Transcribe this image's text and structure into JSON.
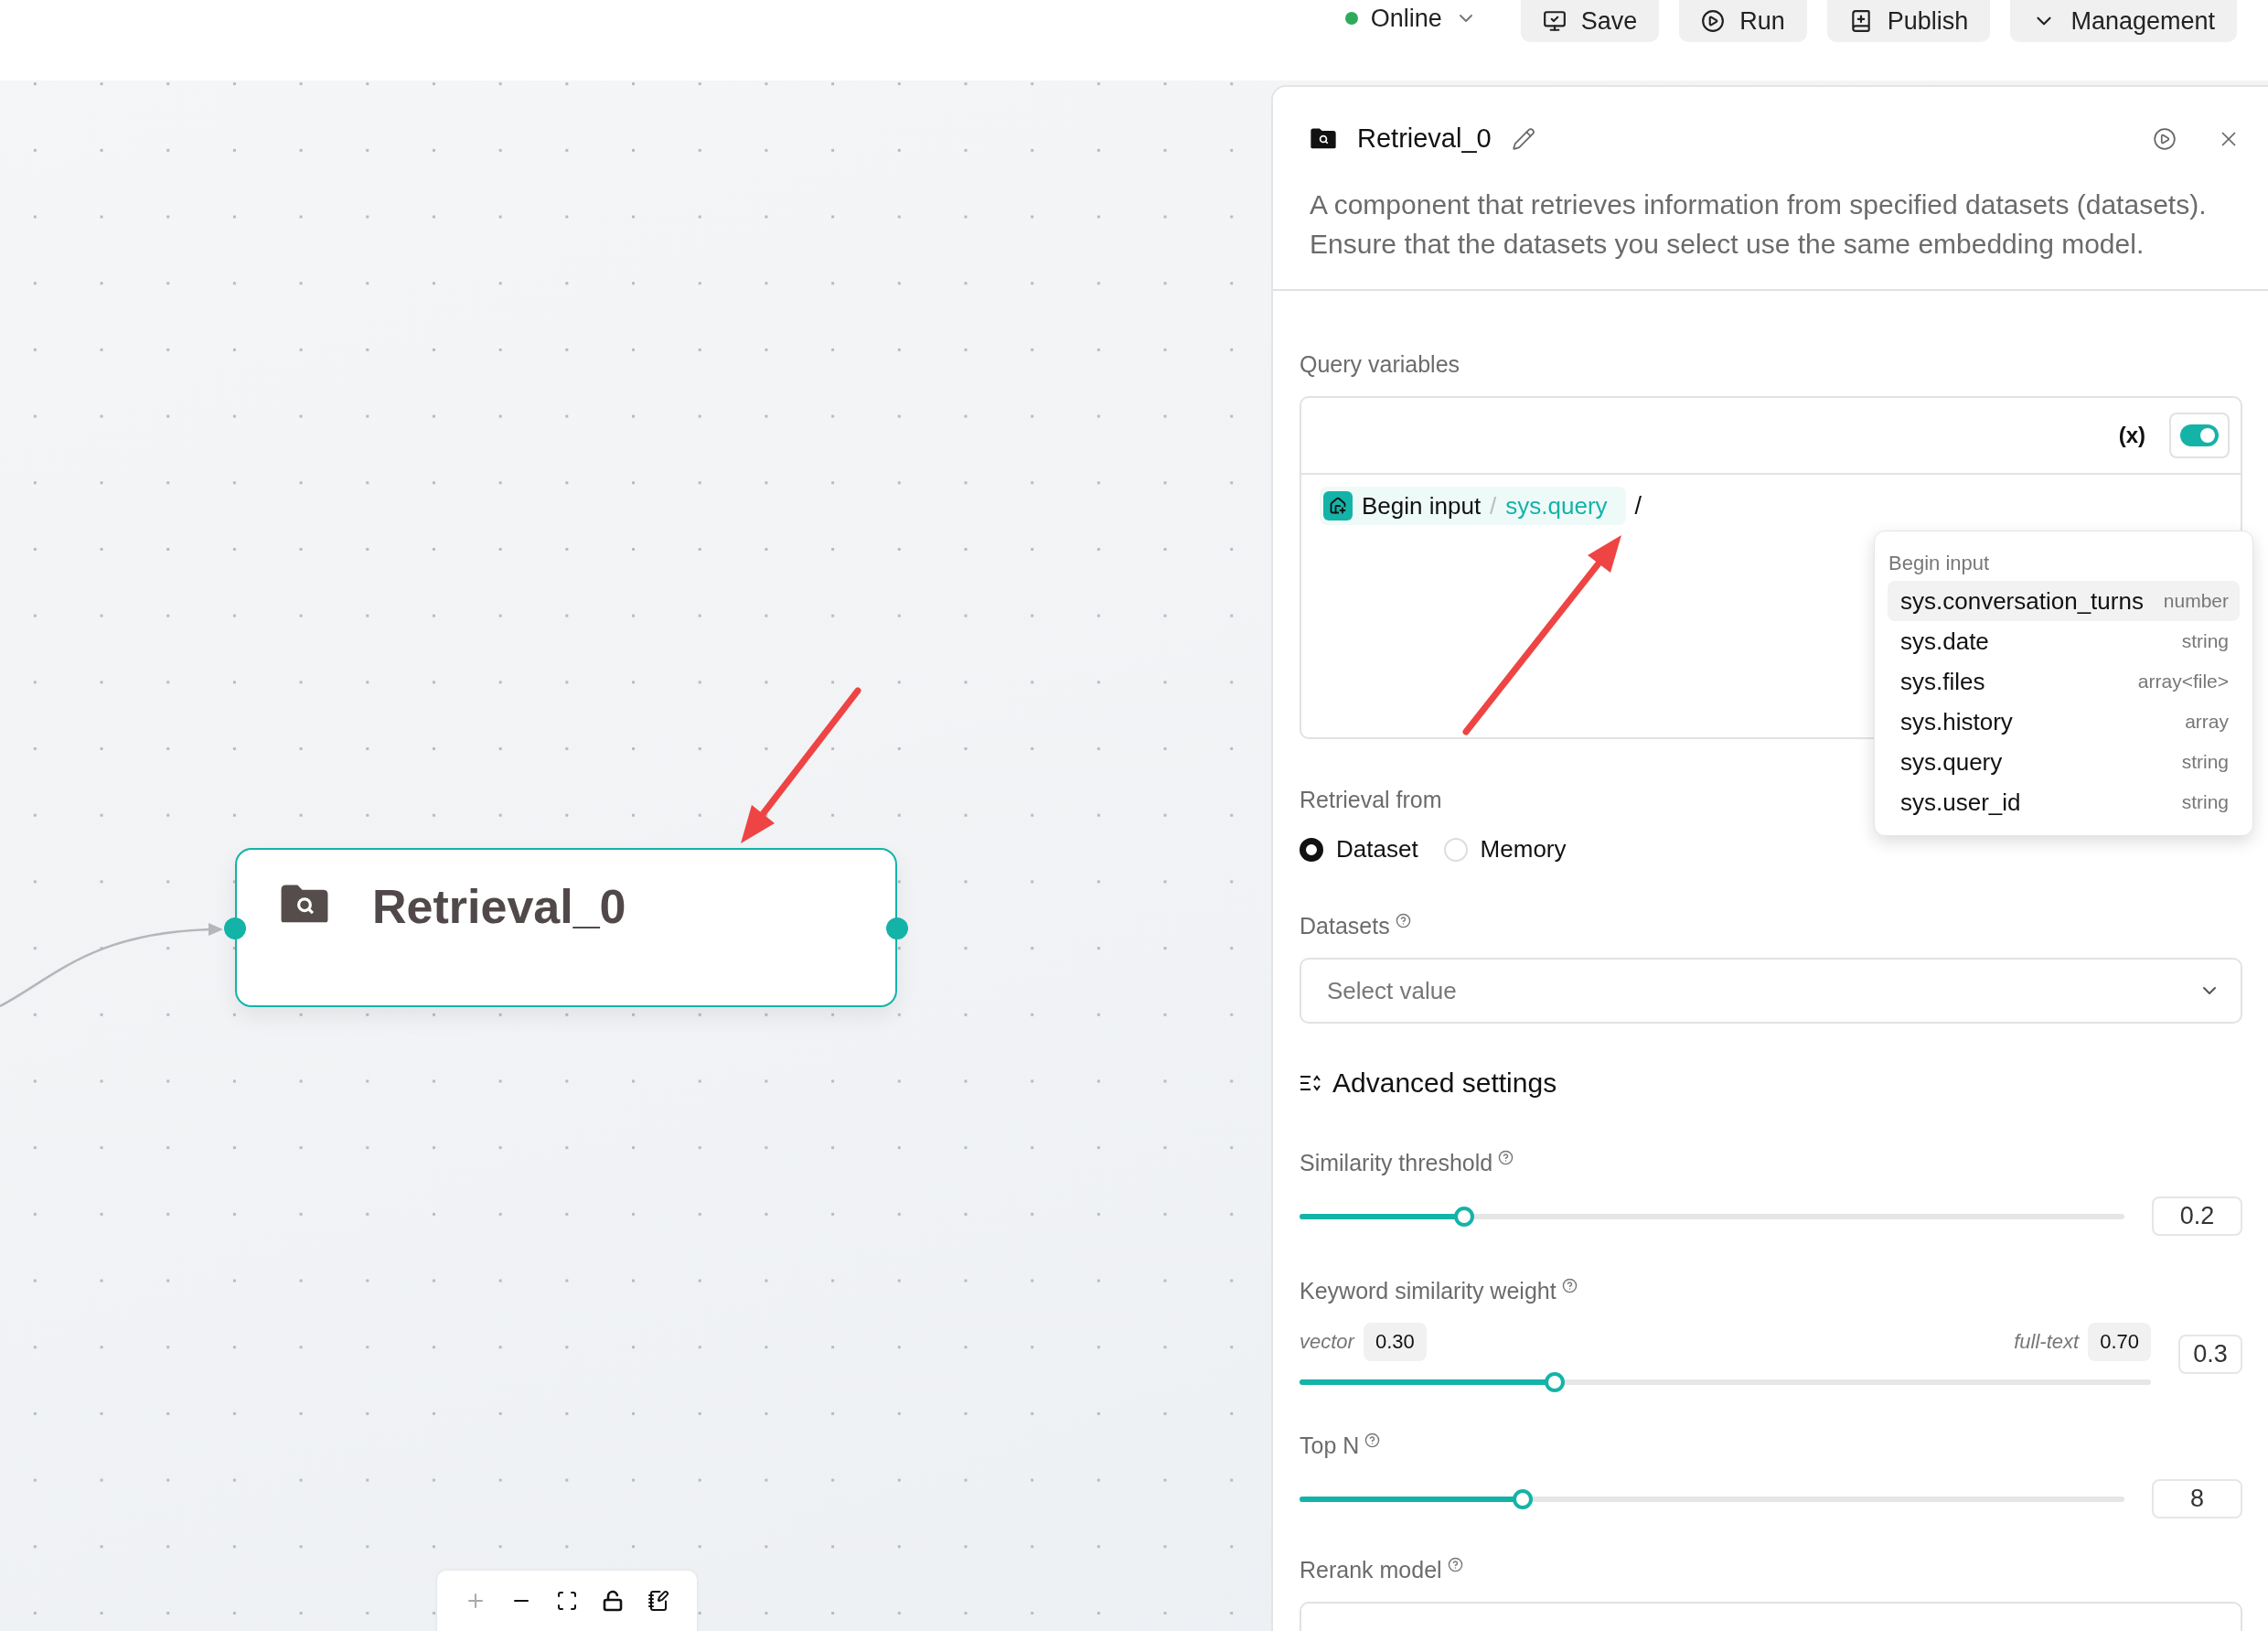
{
  "toolbar": {
    "status": {
      "label": "Online",
      "color": "#2eaa5c"
    },
    "buttons": [
      {
        "kind": "save",
        "label": "Save"
      },
      {
        "kind": "run",
        "label": "Run"
      },
      {
        "kind": "publish",
        "label": "Publish"
      },
      {
        "kind": "management",
        "label": "Management"
      }
    ]
  },
  "canvas": {
    "nodes": [
      {
        "title": "Retrieval_0",
        "selected": true
      }
    ],
    "controls": [
      {
        "kind": "zoom_in",
        "disabled": true
      },
      {
        "kind": "zoom_out",
        "disabled": false
      },
      {
        "kind": "fit",
        "disabled": false
      },
      {
        "kind": "lock",
        "disabled": false
      },
      {
        "kind": "note",
        "disabled": false
      }
    ]
  },
  "panel": {
    "title": "Retrieval_0",
    "description": "A component that retrieves information from specified datasets (datasets). Ensure that the datasets you select use the same embedding model.",
    "query_variables": {
      "label": "Query variables",
      "variable_button": "(x)",
      "toggle_on": true,
      "chip": {
        "node": "Begin input",
        "separator": "/",
        "variable": "sys.query"
      },
      "typed": "/",
      "dropdown": {
        "group": "Begin input",
        "items": [
          {
            "name": "sys.conversation_turns",
            "type": "number",
            "selected": true
          },
          {
            "name": "sys.date",
            "type": "string",
            "selected": false
          },
          {
            "name": "sys.files",
            "type": "array<file>",
            "selected": false
          },
          {
            "name": "sys.history",
            "type": "array",
            "selected": false
          },
          {
            "name": "sys.query",
            "type": "string",
            "selected": false
          },
          {
            "name": "sys.user_id",
            "type": "string",
            "selected": false
          }
        ]
      }
    },
    "retrieval_from": {
      "label": "Retrieval from",
      "options": [
        {
          "label": "Dataset",
          "selected": true
        },
        {
          "label": "Memory",
          "selected": false
        }
      ]
    },
    "datasets": {
      "label": "Datasets",
      "placeholder": "Select value"
    },
    "advanced_settings": {
      "title": "Advanced settings"
    },
    "sliders": [
      {
        "kind": "simple",
        "label": "Similarity threshold",
        "level": 0.2,
        "value": "0.2"
      },
      {
        "kind": "weighted",
        "label": "Keyword similarity weight",
        "left_label": "vector",
        "left_value": "0.30",
        "right_label": "full-text",
        "right_value": "0.70",
        "level": 0.3,
        "value": "0.3"
      },
      {
        "kind": "simple",
        "label": "Top N",
        "level": 0.27,
        "value": "8"
      }
    ],
    "rerank_model": {
      "label": "Rerank model"
    }
  }
}
